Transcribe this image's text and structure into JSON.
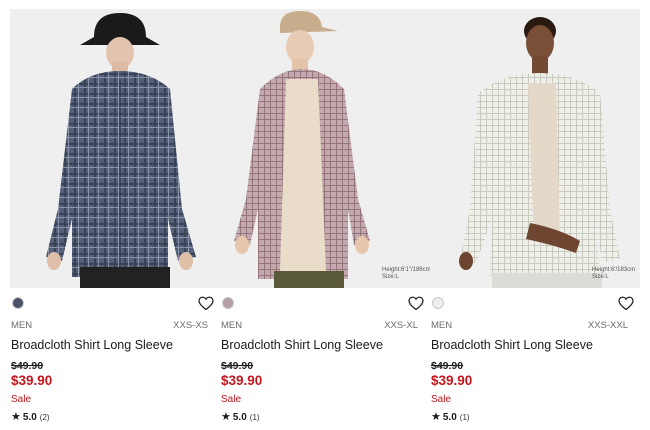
{
  "products": [
    {
      "gender": "MEN",
      "sizes": "XXS-XS",
      "name": "Broadcloth Shirt Long Sleeve",
      "old_price": "$49.90",
      "new_price": "$39.90",
      "sale": "Sale",
      "rating_star": "★",
      "rating": "5.0",
      "reviews": "(2)",
      "model_height": "",
      "model_size": "",
      "swatch_color": "#4a5266",
      "shirt_color": "#4f5a6b"
    },
    {
      "gender": "MEN",
      "sizes": "XXS-XL",
      "name": "Broadcloth Shirt Long Sleeve",
      "old_price": "$49.90",
      "new_price": "$39.90",
      "sale": "Sale",
      "rating_star": "★",
      "rating": "5.0",
      "reviews": "(1)",
      "model_height": "Height:6'1\"/186cm",
      "model_size": "Size:L",
      "swatch_color": "#b79ea3",
      "shirt_color": "#b59aa0"
    },
    {
      "gender": "MEN",
      "sizes": "XXS-XXL",
      "name": "Broadcloth Shirt Long Sleeve",
      "old_price": "$49.90",
      "new_price": "$39.90",
      "sale": "Sale",
      "rating_star": "★",
      "rating": "5.0",
      "reviews": "(1)",
      "model_height": "Height:6'/183cm",
      "model_size": "Size:L",
      "swatch_color": "#eeeeea",
      "shirt_color": "#ebebe4"
    }
  ],
  "colors": {
    "sale_red": "#c4161c",
    "muted_text": "#6b6b6b",
    "photo_bg": "#f0f0f0"
  }
}
